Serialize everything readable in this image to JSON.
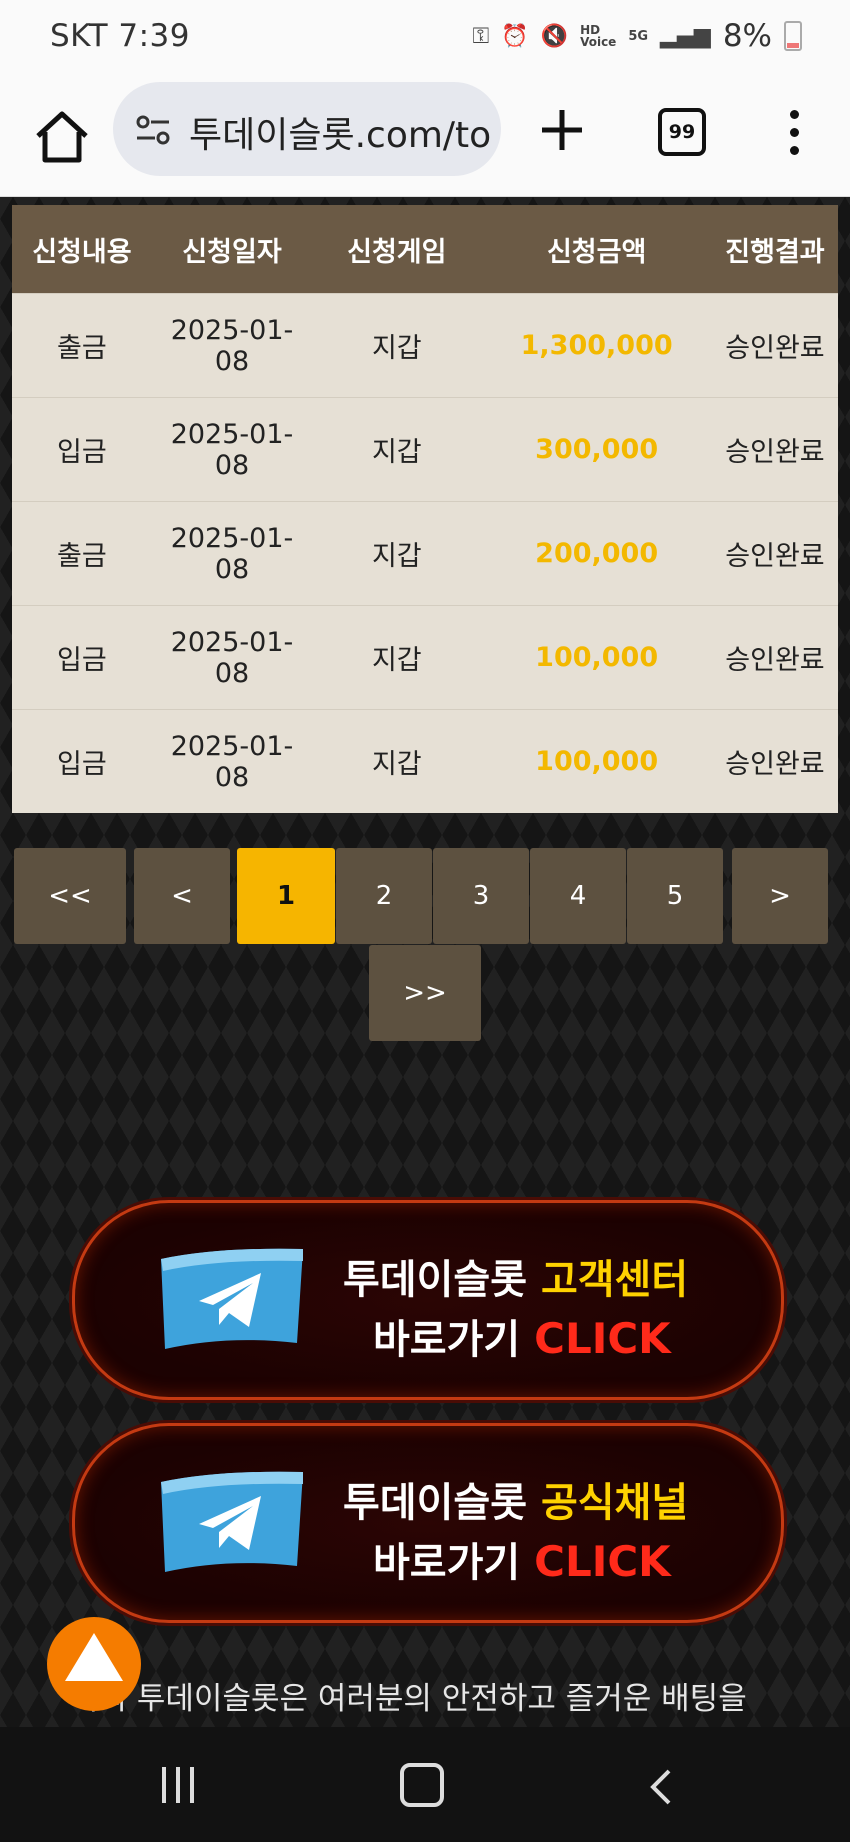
{
  "status_bar": {
    "carrier_time": "SKT 7:39",
    "battery": "8%",
    "icons": [
      "key-icon",
      "alarm-icon",
      "mute-icon",
      "hd-voice-icon",
      "5g-icon",
      "signal-icon",
      "battery-icon"
    ]
  },
  "browser": {
    "url": "투데이슬롯.com/to",
    "tab_count": "99"
  },
  "table": {
    "headers": [
      "신청내용",
      "신청일자",
      "신청게임",
      "신청금액",
      "진행결과"
    ],
    "rows": [
      {
        "type": "출금",
        "date": "2025-01-\n08",
        "game": "지갑",
        "amount": "1,300,000",
        "result": "승인완료"
      },
      {
        "type": "입금",
        "date": "2025-01-\n08",
        "game": "지갑",
        "amount": "300,000",
        "result": "승인완료"
      },
      {
        "type": "출금",
        "date": "2025-01-\n08",
        "game": "지갑",
        "amount": "200,000",
        "result": "승인완료"
      },
      {
        "type": "입금",
        "date": "2025-01-\n08",
        "game": "지갑",
        "amount": "100,000",
        "result": "승인완료"
      },
      {
        "type": "입금",
        "date": "2025-01-\n08",
        "game": "지갑",
        "amount": "100,000",
        "result": "승인완료"
      }
    ]
  },
  "pagination": {
    "first": "<<",
    "prev": "<",
    "pages": [
      "1",
      "2",
      "3",
      "4",
      "5"
    ],
    "active": "1",
    "next": ">",
    "last": ">>"
  },
  "banners": [
    {
      "line1_prefix": "투데이슬롯 ",
      "line1_highlight": "고객센터",
      "line2_prefix": "바로가기 ",
      "line2_click": "CLICK"
    },
    {
      "line1_prefix": "투데이슬롯 ",
      "line1_highlight": "공식채널",
      "line2_prefix": "바로가기 ",
      "line2_click": "CLICK"
    }
  ],
  "footer_text": "저희 투데이슬롯은 여러분의 안전하고 즐거운 배팅을",
  "colors": {
    "header_bg": "#6b5a45",
    "amount": "#f3b800",
    "pager_active": "#f6b500",
    "pager_bg": "#5d5140",
    "scroll_top": "#f57c00"
  }
}
